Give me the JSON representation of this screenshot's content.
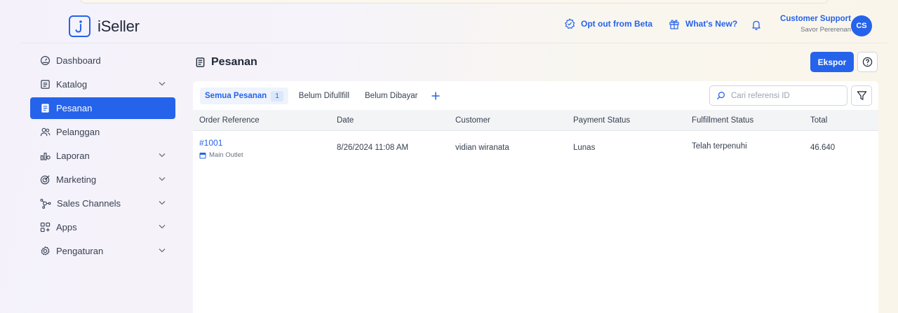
{
  "header": {
    "logo_text": "iSeller",
    "opt_out_label": "Opt out from Beta",
    "whats_new_label": "What's New?",
    "user_name": "Customer Support",
    "user_store": "Savor Pererenan",
    "avatar_initials": "CS"
  },
  "sidebar": {
    "items": [
      {
        "label": "Dashboard",
        "icon": "dashboard-icon",
        "has_chevron": false
      },
      {
        "label": "Katalog",
        "icon": "catalog-icon",
        "has_chevron": true
      },
      {
        "label": "Pesanan",
        "icon": "orders-icon",
        "has_chevron": false,
        "active": true
      },
      {
        "label": "Pelanggan",
        "icon": "customers-icon",
        "has_chevron": false
      },
      {
        "label": "Laporan",
        "icon": "reports-icon",
        "has_chevron": true
      },
      {
        "label": "Marketing",
        "icon": "marketing-icon",
        "has_chevron": true
      },
      {
        "label": "Sales Channels",
        "icon": "channels-icon",
        "has_chevron": true
      },
      {
        "label": "Apps",
        "icon": "apps-icon",
        "has_chevron": true
      },
      {
        "label": "Pengaturan",
        "icon": "settings-icon",
        "has_chevron": true
      }
    ]
  },
  "page": {
    "title": "Pesanan",
    "export_label": "Ekspor"
  },
  "tabs": [
    {
      "label": "Semua Pesanan",
      "count": "1",
      "active": true
    },
    {
      "label": "Belum Difullfill"
    },
    {
      "label": "Belum Dibayar"
    }
  ],
  "search": {
    "placeholder": "Cari referensi ID",
    "value": ""
  },
  "table": {
    "columns": [
      "Order Reference",
      "Date",
      "Customer",
      "Payment Status",
      "Fulfillment Status",
      "Total"
    ],
    "rows": [
      {
        "order_ref": "#1001",
        "outlet": "Main Outlet",
        "date": "8/26/2024 11:08 AM",
        "customer": "vidian wiranata",
        "payment_status": "Lunas",
        "fulfillment_status": "Telah terpenuhi",
        "total": "46.640"
      }
    ]
  },
  "colors": {
    "accent": "#2563eb"
  }
}
